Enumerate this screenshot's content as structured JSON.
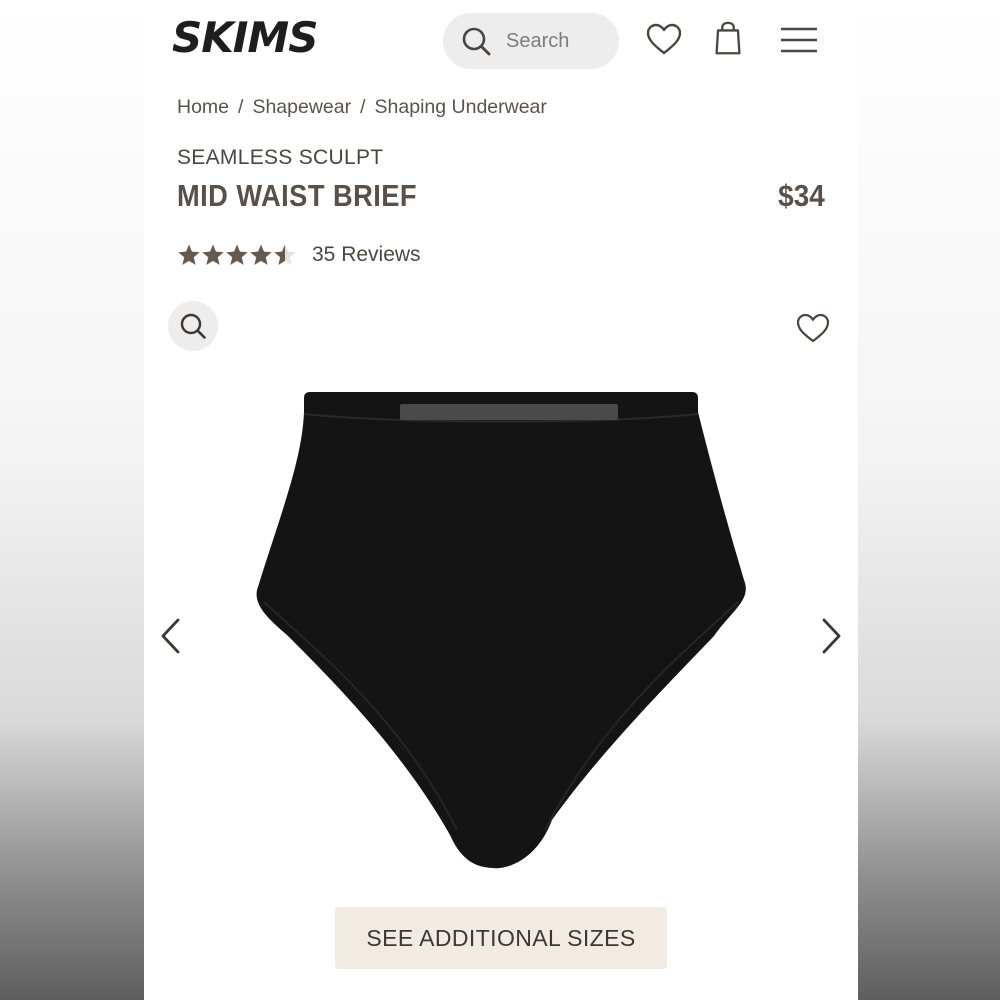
{
  "brand": {
    "logo_text": "SKIMS"
  },
  "header": {
    "search_placeholder": "Search",
    "icons": [
      "search-icon",
      "heart-icon",
      "bag-icon",
      "menu-icon"
    ]
  },
  "breadcrumb": {
    "items": [
      "Home",
      "Shapewear",
      "Shaping Underwear"
    ],
    "separator": "/"
  },
  "product": {
    "collection": "SEAMLESS SCULPT",
    "title": "MID WAIST BRIEF",
    "price": "$34",
    "rating": 4.5,
    "rating_max": 5,
    "reviews_label": "35 Reviews",
    "image_icon_names": [
      "zoom-icon",
      "wishlist-heart-icon",
      "prev-arrow-icon",
      "next-arrow-icon"
    ]
  },
  "cta": {
    "sizes_label": "SEE ADDITIONAL SIZES"
  },
  "colors": {
    "text_brown": "#5b5047",
    "star_fill": "#665a4e",
    "star_empty": "#e3e3e3",
    "button_bg": "#f1ebe3",
    "search_bg": "#ededed",
    "garment": "#141414"
  }
}
